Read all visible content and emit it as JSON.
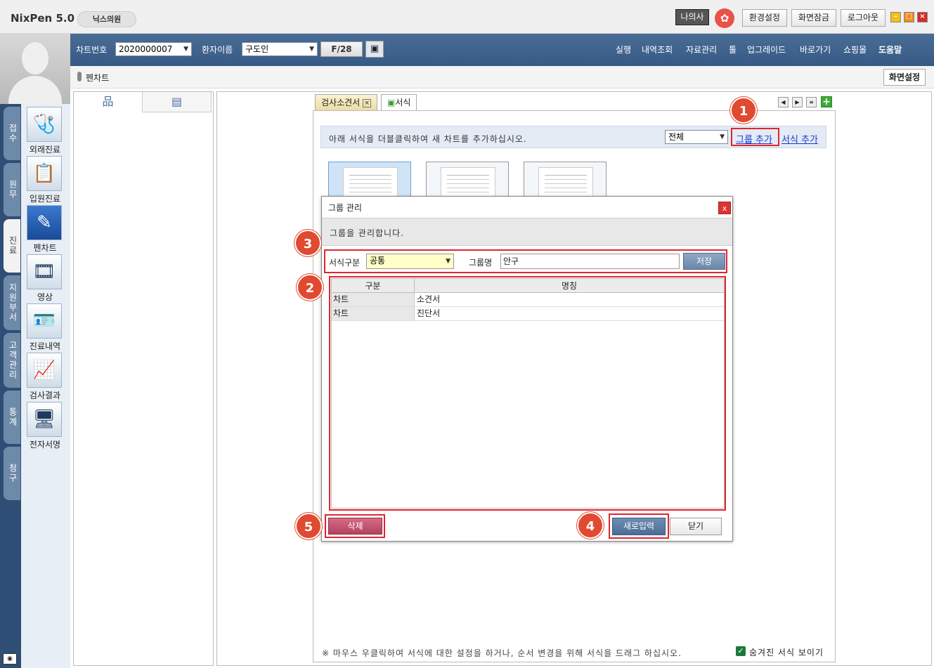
{
  "app": {
    "title": "NixPen 5.0",
    "clinic": "닉스의원"
  },
  "top_buttons": {
    "mine": "나의사",
    "settings": "환경설정",
    "screen_lock": "화면잠금",
    "logout": "로그아웃"
  },
  "navbar": {
    "chart_no_label": "차트번호",
    "chart_no_value": "2020000007",
    "patient_label": "환자이름",
    "patient_value": "구도인",
    "page": "F/28",
    "menus": [
      "실행",
      "내역조회",
      "자료관리",
      "툴",
      "업그레이드",
      "바로가기",
      "쇼핑몰",
      "도움말"
    ]
  },
  "subbar": {
    "title": "펜차트",
    "screen_settings": "화면설정"
  },
  "left_tabs": [
    "접수",
    "원무",
    "진료",
    "지원부서",
    "고객관리",
    "통계",
    "청구"
  ],
  "left_icons": [
    {
      "label": "외래진료",
      "icon": "stethoscope-icon",
      "glyph": "🩺"
    },
    {
      "label": "입원진료",
      "icon": "clipboard-stethoscope-icon",
      "glyph": "📋"
    },
    {
      "label": "펜차트",
      "icon": "pen-chart-icon",
      "glyph": "✎"
    },
    {
      "label": "영상",
      "icon": "film-icon",
      "glyph": "🎞"
    },
    {
      "label": "진료내역",
      "icon": "id-card-icon",
      "glyph": "🪪"
    },
    {
      "label": "검사결과",
      "icon": "ecg-clipboard-icon",
      "glyph": "📈"
    },
    {
      "label": "전자서명",
      "icon": "monitor-sign-icon",
      "glyph": "🖥"
    }
  ],
  "doc_tabs": {
    "tab1": "검사소견서",
    "tab2": "서식"
  },
  "forms": {
    "info": "아래 서식을 더블클릭하여 새 차트를 추가하십시오.",
    "filter_value": "전체",
    "group_add": "그룹 추가",
    "form_add": "서식 추가",
    "footnote": "※ 마우스 우클릭하여 서식에 대한 설정을 하거나, 순서 변경을 위해 서식을 드래그 하십시오.",
    "show_hidden": "숨겨진 서식 보이기"
  },
  "dialog": {
    "title": "그룹 관리",
    "close": "x",
    "description": "그룹을 관리합니다.",
    "type_label": "서식구분",
    "type_value": "공통",
    "name_label": "그룹명",
    "name_value": "안구",
    "save": "저장",
    "columns": [
      "구분",
      "명칭"
    ],
    "rows": [
      {
        "type": "차트",
        "name": "소견서"
      },
      {
        "type": "차트",
        "name": "진단서"
      }
    ],
    "delete": "삭제",
    "new": "새로입력",
    "close_btn": "닫기"
  },
  "callouts": [
    "1",
    "2",
    "3",
    "4",
    "5"
  ],
  "colors": {
    "nav_blue": "#365a85",
    "callout": "#e04a31",
    "highlight_border": "#e0262f",
    "link": "#1a37d0"
  }
}
